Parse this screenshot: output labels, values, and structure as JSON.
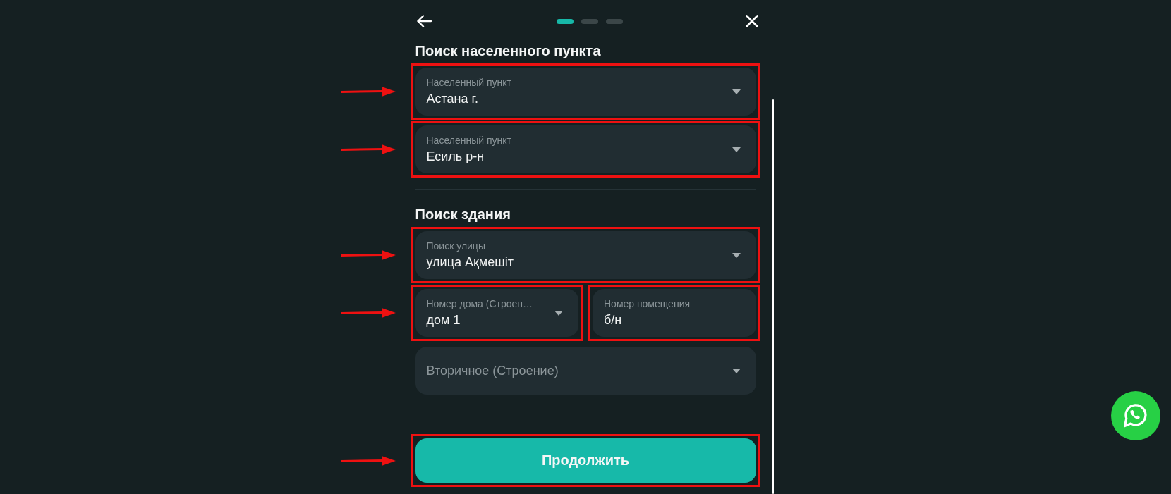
{
  "header": {
    "steps": [
      {
        "selected": true
      },
      {
        "selected": false
      },
      {
        "selected": false
      }
    ]
  },
  "sections": [
    {
      "title": "Поиск населенного пункта",
      "rows": [
        {
          "arrow": true,
          "fields": [
            {
              "kind": "dropdown",
              "label": "Населенный пункт",
              "value": "Астана г.",
              "highlighted": true
            }
          ]
        },
        {
          "arrow": true,
          "fields": [
            {
              "kind": "dropdown",
              "label": "Населенный пункт",
              "value": "Есиль р-н",
              "highlighted": true
            }
          ]
        }
      ]
    },
    {
      "title": "Поиск здания",
      "rows": [
        {
          "arrow": true,
          "fields": [
            {
              "kind": "dropdown",
              "label": "Поиск улицы",
              "value": "улица Ақмешіт",
              "highlighted": true
            }
          ]
        },
        {
          "arrow": true,
          "fields": [
            {
              "kind": "dropdown",
              "label": "Номер дома (Строен…",
              "value": "дом 1",
              "highlighted": true
            },
            {
              "kind": "text",
              "label": "Номер помещения",
              "value": "б/н",
              "highlighted": true
            }
          ]
        },
        {
          "arrow": false,
          "fields": [
            {
              "kind": "dropdown",
              "placeholder": "Вторичное (Строение)",
              "highlighted": false
            }
          ]
        }
      ]
    }
  ],
  "continue_button": {
    "label": "Продолжить",
    "highlighted": true,
    "arrow": true
  }
}
